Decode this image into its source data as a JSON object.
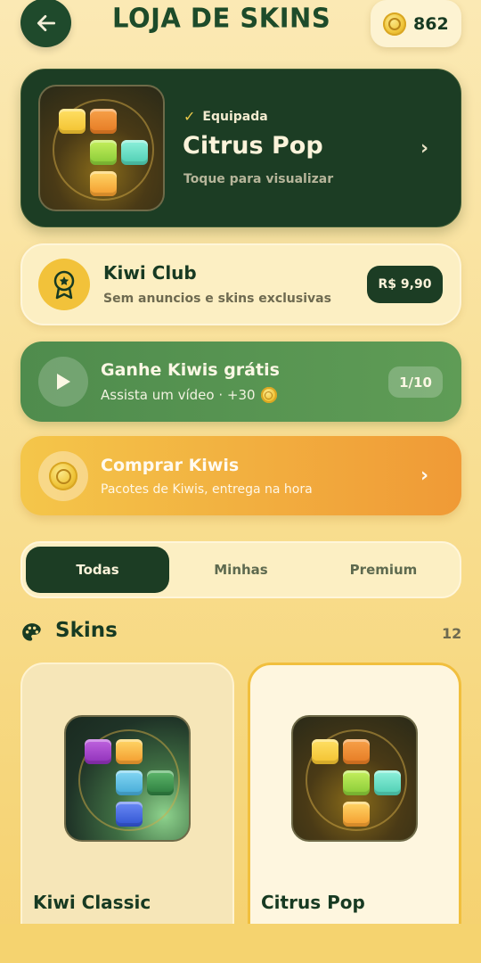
{
  "header": {
    "title": "LOJA DE SKINS",
    "coins": "862"
  },
  "equipped": {
    "badge": "Equipada",
    "name": "Citrus Pop",
    "hint": "Toque para visualizar"
  },
  "club": {
    "title": "Kiwi Club",
    "subtitle": "Sem anuncios e skins exclusivas",
    "price": "R$ 9,90"
  },
  "free_kiwis": {
    "title": "Ganhe Kiwis grátis",
    "subtitle": "Assista um vídeo · +30",
    "progress": "1/10"
  },
  "buy_kiwis": {
    "title": "Comprar Kiwis",
    "subtitle": "Pacotes de Kiwis, entrega na hora"
  },
  "tabs": [
    {
      "label": "Todas",
      "active": true
    },
    {
      "label": "Minhas",
      "active": false
    },
    {
      "label": "Premium",
      "active": false
    }
  ],
  "skins": {
    "title": "Skins",
    "count": "12",
    "items": [
      {
        "name": "Kiwi Classic",
        "selected": false
      },
      {
        "name": "Citrus Pop",
        "selected": true
      }
    ]
  },
  "colors": {
    "dark_green": "#1c3d24",
    "accent_gold": "#f2c23a",
    "free_green": "#5f9c56",
    "buy_orange": "#f09a36"
  }
}
